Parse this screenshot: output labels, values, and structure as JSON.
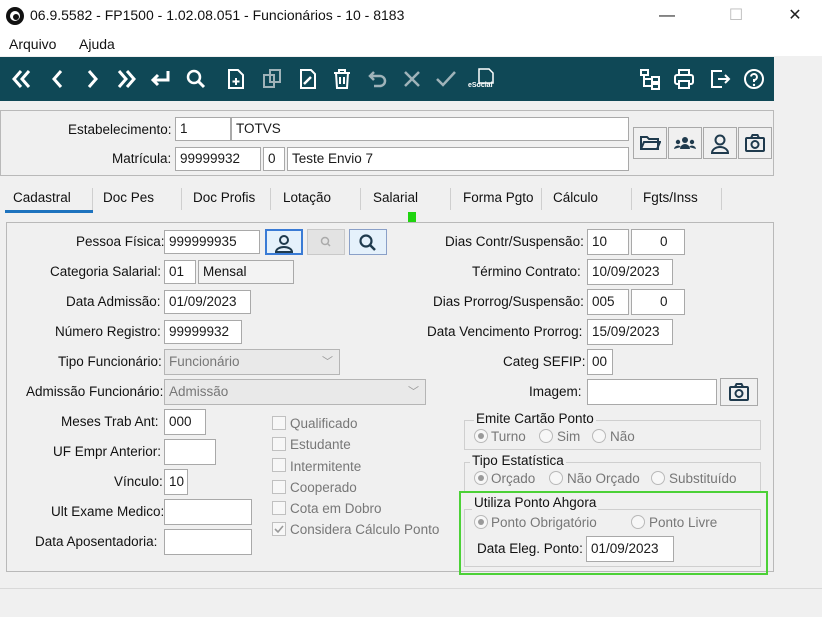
{
  "window": {
    "title": "06.9.5582 - FP1500 - 1.02.08.051 - Funcionários - 10 - 8183",
    "minimize": "—",
    "maximize": "☐",
    "close": "✕"
  },
  "menu": [
    "Arquivo",
    "Ajuda"
  ],
  "toolbar": {
    "background": "#0f4856",
    "esocial_label": "eSocial",
    "buttons": [
      "first-icon",
      "previous-icon",
      "next-icon",
      "last-icon",
      "return-icon",
      "search-icon",
      "new-document-icon",
      "copy-icon",
      "edit-icon",
      "delete-icon",
      "undo-icon",
      "cancel-icon",
      "confirm-icon",
      "esocial-icon",
      "hierarchy-icon",
      "print-icon",
      "exit-icon",
      "help-icon"
    ]
  },
  "header": {
    "estabelecimento_label": "Estabelecimento:",
    "estabelecimento_code": "1",
    "estabelecimento_name": "TOTVS",
    "matricula_label": "Matrícula:",
    "matricula_value": "99999932",
    "matricula_digit": "0",
    "matricula_name": "Teste Envio 7",
    "buttons": [
      "folder-icon",
      "group-icon",
      "person-icon",
      "camera-icon"
    ]
  },
  "tabs": [
    "Cadastral",
    "Doc Pes",
    "Doc Profis",
    "Lotação",
    "Salarial",
    "Forma Pgto",
    "Cálculo",
    "Fgts/Inss"
  ],
  "active_tab": "Cadastral",
  "form": {
    "pessoa_fisica_label": "Pessoa Física:",
    "pessoa_fisica_value": "999999935",
    "categoria_label": "Categoria Salarial:",
    "categoria_code": "01",
    "categoria_name": "Mensal",
    "data_admissao_label": "Data Admissão:",
    "data_admissao_value": "01/09/2023",
    "numero_registro_label": "Número Registro:",
    "numero_registro_value": "99999932",
    "tipo_funcionario_label": "Tipo Funcionário:",
    "tipo_funcionario_value": "Funcionário",
    "admissao_funcionario_label": "Admissão Funcionário:",
    "admissao_funcionario_value": "Admissão",
    "meses_trab_label": "Meses Trab Ant:",
    "meses_trab_value": "000",
    "uf_empr_label": "UF Empr Anterior:",
    "uf_empr_value": "",
    "vinculo_label": "Vínculo:",
    "vinculo_value": "10",
    "ult_exame_label": "Ult Exame Medico:",
    "ult_exame_value": "",
    "data_aposentadoria_label": "Data Aposentadoria:",
    "data_aposentadoria_value": "",
    "checkboxes": [
      {
        "label": "Qualificado",
        "checked": false
      },
      {
        "label": "Estudante",
        "checked": false
      },
      {
        "label": "Intermitente",
        "checked": false
      },
      {
        "label": "Cooperado",
        "checked": false
      },
      {
        "label": "Cota em Dobro",
        "checked": false
      },
      {
        "label": "Considera Cálculo Ponto",
        "checked": true
      }
    ],
    "dias_contr_label": "Dias Contr/Suspensão:",
    "dias_contr_value1": "10",
    "dias_contr_value2": "0",
    "termino_contrato_label": "Término Contrato:",
    "termino_contrato_value": "10/09/2023",
    "dias_prorrog_label": "Dias Prorrog/Suspensão:",
    "dias_prorrog_value1": "005",
    "dias_prorrog_value2": "0",
    "data_venc_label": "Data Vencimento Prorrog:",
    "data_venc_value": "15/09/2023",
    "categ_sefip_label": "Categ SEFIP:",
    "categ_sefip_value": "00",
    "imagem_label": "Imagem:",
    "imagem_value": "",
    "emite_cartao": {
      "title": "Emite Cartão Ponto",
      "options": [
        "Turno",
        "Sim",
        "Não"
      ],
      "selected": "Turno"
    },
    "tipo_estatistica": {
      "title": "Tipo Estatística",
      "options": [
        "Orçado",
        "Não Orçado",
        "Substituído"
      ],
      "selected": "Orçado"
    },
    "utiliza_ponto": {
      "title": "Utiliza Ponto Ahgora",
      "options": [
        "Ponto Obrigatório",
        "Ponto Livre"
      ],
      "selected": "Ponto Obrigatório",
      "data_eleg_label": "Data Eleg. Ponto:",
      "data_eleg_value": "01/09/2023"
    }
  },
  "colors": {
    "highlight_green": "#4cd137",
    "tab_underline": "#1e73be"
  }
}
